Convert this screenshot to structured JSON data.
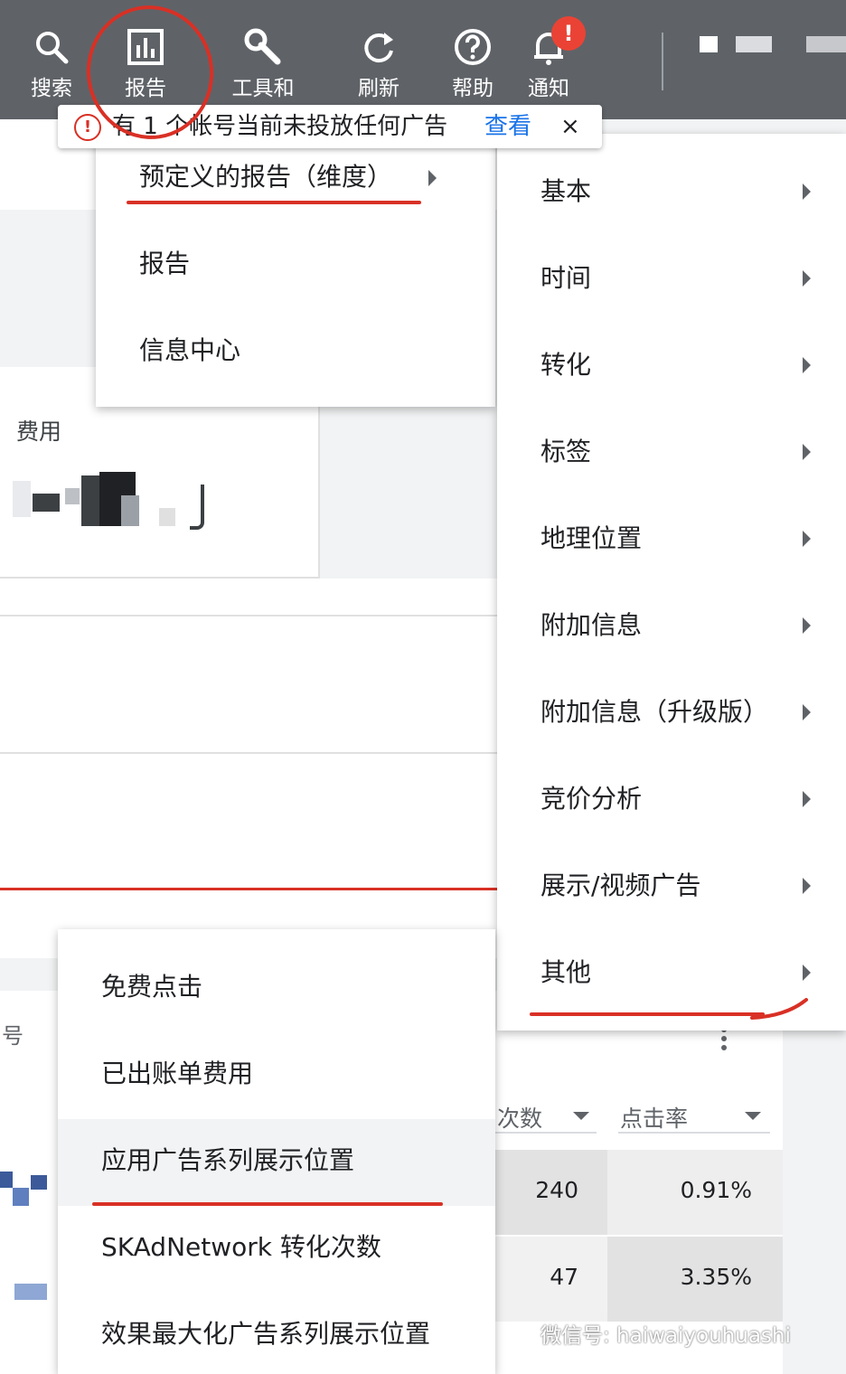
{
  "toolbar": {
    "items": [
      {
        "label": "搜索",
        "icon": "search-icon"
      },
      {
        "label": "报告",
        "icon": "report-chart-icon"
      },
      {
        "label": "工具和",
        "icon": "wrench-icon"
      },
      {
        "label": "刷新",
        "icon": "refresh-icon"
      },
      {
        "label": "帮助",
        "icon": "help-icon"
      },
      {
        "label": "通知",
        "icon": "bell-icon"
      }
    ],
    "notification_badge": "!"
  },
  "alert": {
    "message": "有 1 个帐号当前未投放任何广告",
    "link": "查看",
    "close": "×"
  },
  "report_menu": {
    "items": [
      "预定义的报告（维度）",
      "报告",
      "信息中心"
    ]
  },
  "predefined_submenu": {
    "items": [
      "基本",
      "时间",
      "转化",
      "标签",
      "地理位置",
      "附加信息",
      "附加信息（升级版）",
      "竞价分析",
      "展示/视频广告",
      "其他"
    ]
  },
  "other_submenu": {
    "items": [
      "免费点击",
      "已出账单费用",
      "应用广告系列展示位置",
      "SKAdNetwork 转化次数",
      "效果最大化广告系列展示位置"
    ]
  },
  "background": {
    "cost_label": "费用",
    "left_row_label": "号",
    "columns": [
      {
        "label": "次数"
      },
      {
        "label": "点击率"
      }
    ],
    "rows": [
      {
        "count": "240",
        "ctr": "0.91%"
      },
      {
        "count": "47",
        "ctr": "3.35%"
      }
    ],
    "more_icon": "more-vert-icon"
  },
  "watermark": "微信号: haiwaiyouhuashi",
  "colors": {
    "toolbar": "#5f6368",
    "accent_link": "#1a73e8",
    "annotation_red": "#d93025"
  }
}
